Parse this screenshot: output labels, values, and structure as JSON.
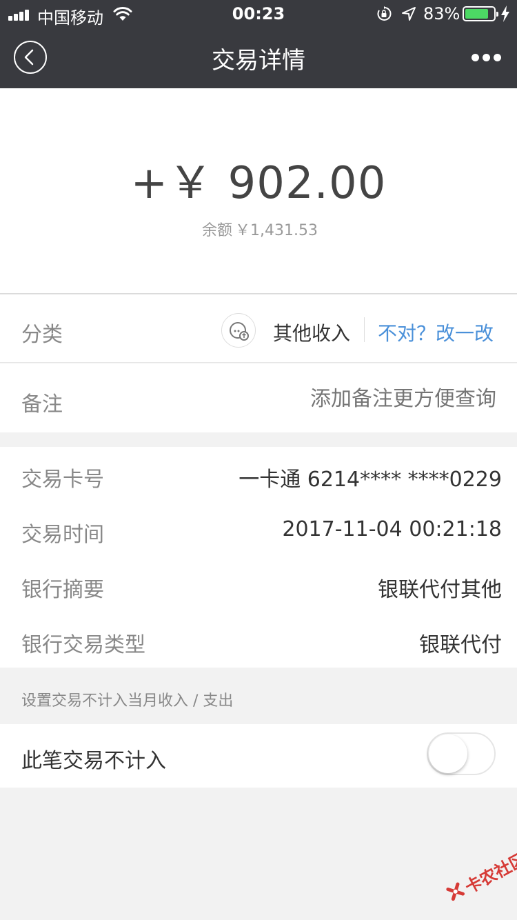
{
  "status_bar": {
    "carrier": "中国移动",
    "time": "00:23",
    "battery_percent": "83%",
    "battery_level": 0.83,
    "icons": [
      "signal-icon",
      "wifi-icon",
      "orientation-lock-icon",
      "location-icon",
      "battery-icon",
      "charging-icon"
    ]
  },
  "nav": {
    "title": "交易详情",
    "back_icon": "back-icon",
    "more_icon": "more-icon"
  },
  "amount": {
    "value": "+￥ 902.00",
    "balance_label": "余额",
    "balance_value": "￥1,431.53"
  },
  "category": {
    "label": "分类",
    "icon": "category-icon",
    "name": "其他收入",
    "fix_link": "不对？改一改"
  },
  "note": {
    "label": "备注",
    "placeholder": "添加备注更方便查询"
  },
  "details": [
    {
      "label": "交易卡号",
      "value": "一卡通 6214**** ****0229"
    },
    {
      "label": "交易时间",
      "value": "2017-11-04 00:21:18"
    },
    {
      "label": "银行摘要",
      "value": "银联代付其他"
    },
    {
      "label": "银行交易类型",
      "value": "银联代付"
    }
  ],
  "exclude": {
    "hint": "设置交易不计入当月收入 / 支出",
    "label": "此笔交易不计入",
    "enabled": false
  },
  "watermark": {
    "text": "卡农社区"
  },
  "colors": {
    "nav_bg": "#393a3f",
    "link": "#4a90d9",
    "battery": "#4cd964",
    "watermark": "#d63a36"
  }
}
